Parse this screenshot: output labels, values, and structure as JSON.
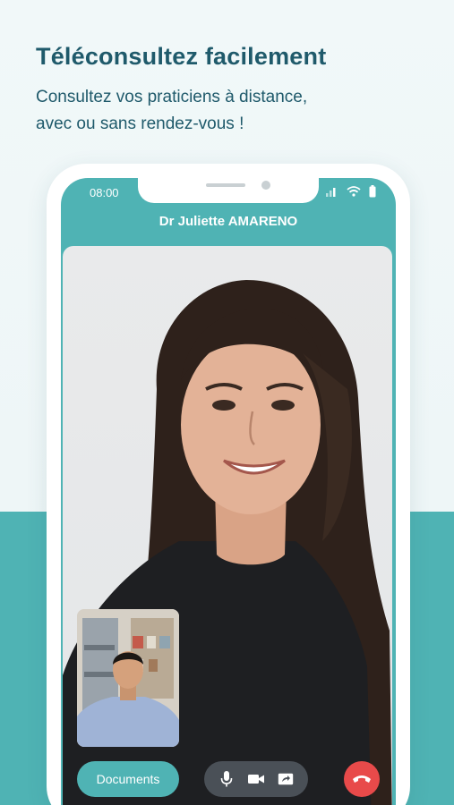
{
  "hero": {
    "title": "Téléconsultez facilement",
    "subtitle_line1": "Consultez vos praticiens à distance,",
    "subtitle_line2": "avec ou sans rendez-vous !"
  },
  "phone": {
    "status_bar": {
      "time": "08:00"
    },
    "call": {
      "doctor_name": "Dr Juliette AMARENO",
      "documents_label": "Documents",
      "controls": [
        "microphone-icon",
        "video-camera-icon",
        "screen-share-icon"
      ],
      "hangup_icon": "hang-up-icon"
    }
  },
  "colors": {
    "accent": "#4fb3b4",
    "heading": "#1f5a6b",
    "hangup": "#e84a4a",
    "controls_bg": "#4a5057"
  }
}
